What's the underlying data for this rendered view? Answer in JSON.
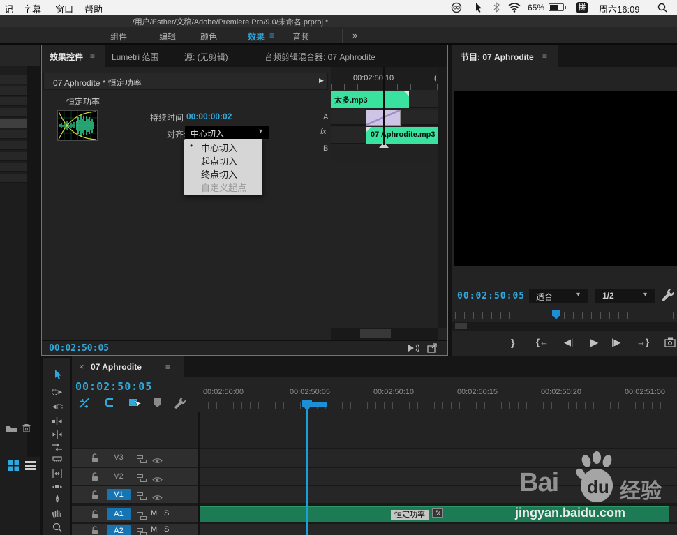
{
  "glyphs": {
    "panel_menu": "≡",
    "caret_down": "▾",
    "expand_arrow": "▶",
    "overflow": "»",
    "close": "×",
    "bullet": "•"
  },
  "colors": {
    "accent_blue": "#2fa9dd",
    "focus_border": "#2a8ac6",
    "clip_green_bright": "#3ae2a0",
    "clip_green_dark": "#1c7a54",
    "track_target_blue": "#1774b3",
    "transition_lavender": "#cdc4e6",
    "playhead_cyan": "#1b9fd8"
  },
  "menubar": {
    "menus": [
      "记",
      "字幕",
      "窗口",
      "帮助"
    ],
    "battery_percent": "65%",
    "input_method": "拼",
    "clock": "周六16:09"
  },
  "titlebar": {
    "title": "/用户/Esther/文稿/Adobe/Premiere Pro/9.0/未命名.prproj *"
  },
  "workspace": {
    "tabs": [
      "组件",
      "编辑",
      "颜色",
      "效果",
      "音频"
    ],
    "active_tab": "效果"
  },
  "effect_controls": {
    "tabs": [
      "效果控件",
      "Lumetri 范围",
      "源: (无剪辑)",
      "音频剪辑混合器: 07 Aphrodite"
    ],
    "clip_header": "07 Aphrodite * 恒定功率",
    "effect_name": "恒定功率",
    "duration_label": "持续时间",
    "duration_value": "00:00:00:02",
    "alignment_label": "对齐:",
    "alignment_value": "中心切入",
    "dropdown_items": [
      {
        "label": "中心切入",
        "selected": true,
        "disabled": false
      },
      {
        "label": "起点切入",
        "selected": false,
        "disabled": false
      },
      {
        "label": "终点切入",
        "selected": false,
        "disabled": false
      },
      {
        "label": "自定义起点",
        "selected": false,
        "disabled": true
      }
    ],
    "lane_a": "A",
    "lane_fx": "fx",
    "lane_b": "B",
    "mini_ruler_label": "00:02:50:10",
    "mini_ruler_partial": "(",
    "clip_a_name": "太多.mp3",
    "clip_b_name": "07 Aphrodite.mp3",
    "status_timecode": "00:02:50:05"
  },
  "program_monitor": {
    "tab": "节目: 07 Aphrodite",
    "timecode": "00:02:50:05",
    "zoom_level": "适合",
    "playback_resolution": "1/2",
    "transport": {
      "mark_out": "}",
      "go_to_in": "{←",
      "step_back": "◀|",
      "play": "▶",
      "step_forward": "|▶",
      "go_to_out": "→}"
    }
  },
  "timeline": {
    "tab_title": "07 Aphrodite",
    "timecode": "00:02:50:05",
    "ruler_labels": [
      "00:02:50:00",
      "00:02:50:05",
      "00:02:50:10",
      "00:02:50:15",
      "00:02:50:20",
      "00:02:51:00"
    ],
    "video_tracks": [
      "V3",
      "V2",
      "V1"
    ],
    "audio_tracks": [
      "A1",
      "A2"
    ],
    "mute": "M",
    "solo": "S",
    "transition_label": "恒定功率",
    "fx_badge": "fx"
  },
  "watermark": {
    "brand_bai": "Bai",
    "brand_du": "du",
    "brand_suffix": "经验",
    "url": "jingyan.baidu.com"
  }
}
